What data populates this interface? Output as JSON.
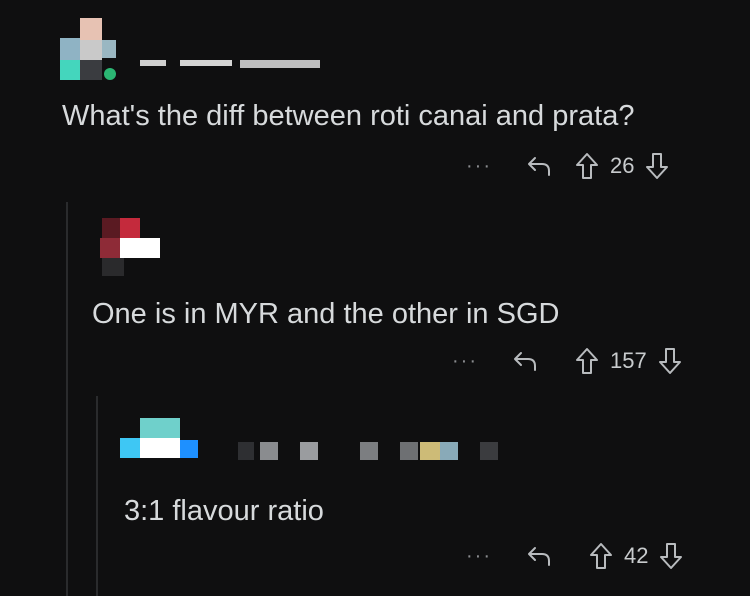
{
  "comments": [
    {
      "username": "",
      "text": "What's the diff between roti canai and prata?",
      "votes": "26"
    },
    {
      "username": "",
      "text": "One is in MYR and the other in SGD",
      "votes": "157"
    },
    {
      "username": "",
      "text": "3:1 flavour ratio",
      "votes": "42"
    }
  ],
  "actions": {
    "more_label": "···"
  },
  "colors": {
    "background": "#0f0f10",
    "text": "#d7dadc",
    "icon": "#b8bbbe",
    "thread_line": "#2a2b2d"
  },
  "icons": [
    "reply-icon",
    "upvote-icon",
    "downvote-icon",
    "more-icon"
  ]
}
